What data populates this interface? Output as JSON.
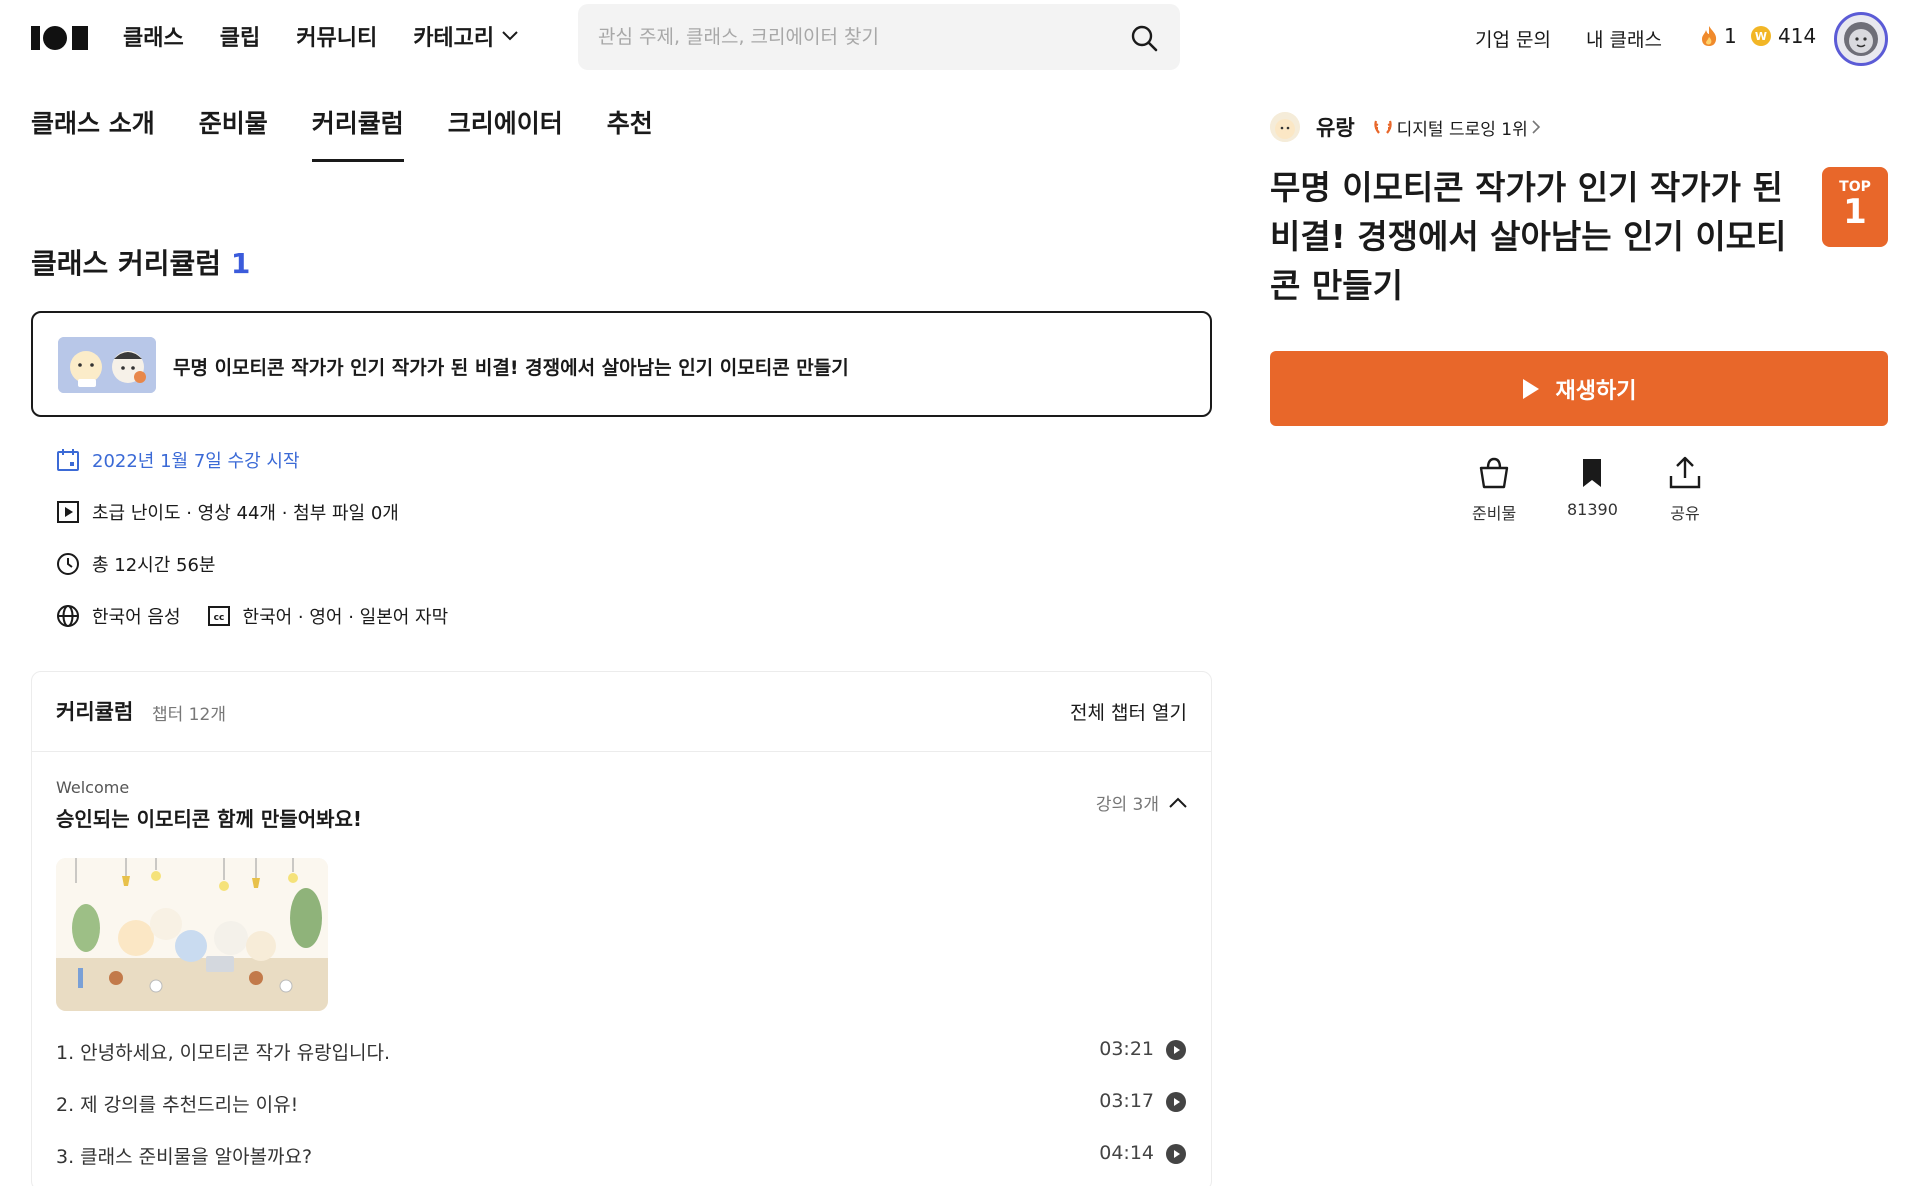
{
  "nav": {
    "logo": "101",
    "items": [
      "클래스",
      "클립",
      "커뮤니티",
      "카테고리"
    ],
    "search_placeholder": "관심 주제, 클래스, 크리에이터 찾기",
    "links": {
      "business": "기업 문의",
      "my_class": "내 클래스"
    },
    "fire_count": "1",
    "coin_count": "414"
  },
  "tabs": [
    {
      "label": "클래스 소개",
      "active": false
    },
    {
      "label": "준비물",
      "active": false
    },
    {
      "label": "커리큘럼",
      "active": true
    },
    {
      "label": "크리에이터",
      "active": false
    },
    {
      "label": "추천",
      "active": false
    }
  ],
  "curriculum": {
    "title": "클래스 커리큘럼",
    "count": "1",
    "class_name": "무명 이모티콘 작가가 인기 작가가 된 비결! 경쟁에서 살아남는 인기 이모티콘 만들기",
    "start_date": "2022년 1월 7일 수강 시작",
    "level_info": "초급 난이도 · 영상 44개 · 첨부 파일 0개",
    "duration": "총 12시간 56분",
    "audio": "한국어 음성",
    "subtitles": "한국어 · 영어 · 일본어 자막",
    "box_title": "커리큘럼",
    "chapter_count": "챕터 12개",
    "open_all": "전체 챕터 열기",
    "chapter": {
      "label": "Welcome",
      "title": "승인되는 이모티콘 함께 만들어봐요!",
      "lecture_count": "강의 3개",
      "lessons": [
        {
          "title": "1. 안녕하세요, 이모티콘 작가 유랑입니다.",
          "duration": "03:21"
        },
        {
          "title": "2. 제 강의를 추천드리는 이유!",
          "duration": "03:17"
        },
        {
          "title": "3. 클래스 준비물을 알아볼까요?",
          "duration": "04:14"
        }
      ]
    }
  },
  "side": {
    "creator": "유랑",
    "rank": "디지털 드로잉 1위",
    "class_title": "무명 이모티콘 작가가 인기 작가가 된 비결! 경쟁에서 살아남는 인기 이모티콘 만들기",
    "badge_top": "TOP",
    "badge_rank": "1",
    "play_label": "재생하기",
    "actions": {
      "supplies": "준비물",
      "bookmarks": "81390",
      "share": "공유"
    }
  },
  "colors": {
    "accent": "#e8672a",
    "link_blue": "#3b6ad6",
    "count_blue": "#3b5bdb"
  }
}
